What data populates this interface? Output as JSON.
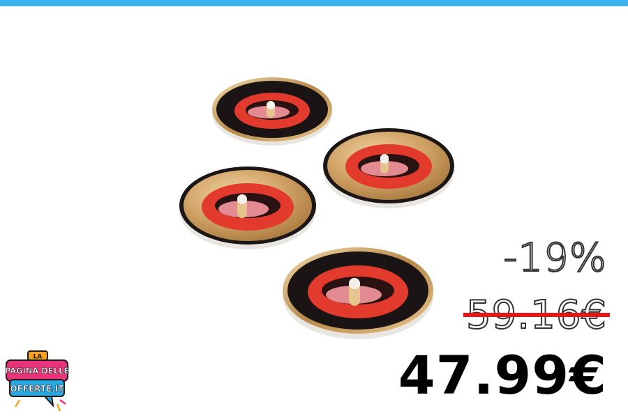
{
  "header": {
    "accent_color": "#3fb3f2"
  },
  "product": {
    "image_icon": "lips-coaster-set-image",
    "coaster_count": 4
  },
  "pricing": {
    "discount": "-19%",
    "old_price": "59.16€",
    "new_price": "47.99€",
    "strike_color": "#e41818"
  },
  "logo": {
    "line1": "LA",
    "line2": "PAGINA DELLE",
    "line3": "OFFERTE.IT",
    "colors": {
      "pink": "#e8337a",
      "blue": "#29a8e0",
      "orange": "#f6a21e"
    }
  }
}
